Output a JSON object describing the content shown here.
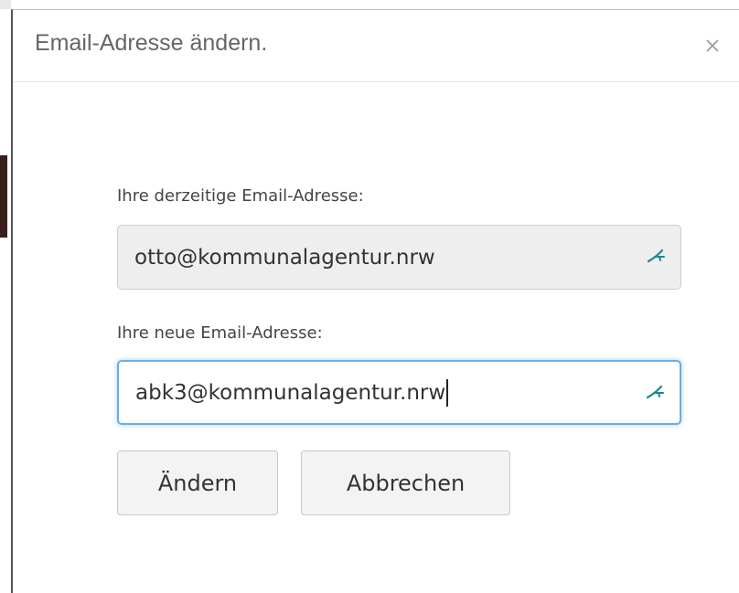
{
  "dialog": {
    "title": "Email-Adresse ändern.",
    "close_label": "×"
  },
  "form": {
    "current_email": {
      "label": "Ihre derzeitige Email-Adresse:",
      "value": "otto@kommunalagentur.nrw",
      "readonly": true
    },
    "new_email": {
      "label": "Ihre neue Email-Adresse:",
      "value": "abk3@kommunalagentur.nrw",
      "focused": true
    }
  },
  "buttons": {
    "change_label": "Ändern",
    "cancel_label": "Abbrechen"
  },
  "colors": {
    "focus_border": "#66afe9",
    "autofill_icon": "#1a8a8a",
    "readonly_bg": "#eeeeee"
  },
  "icons": {
    "close": "close-icon",
    "autofill": "password-manager-key-icon"
  }
}
